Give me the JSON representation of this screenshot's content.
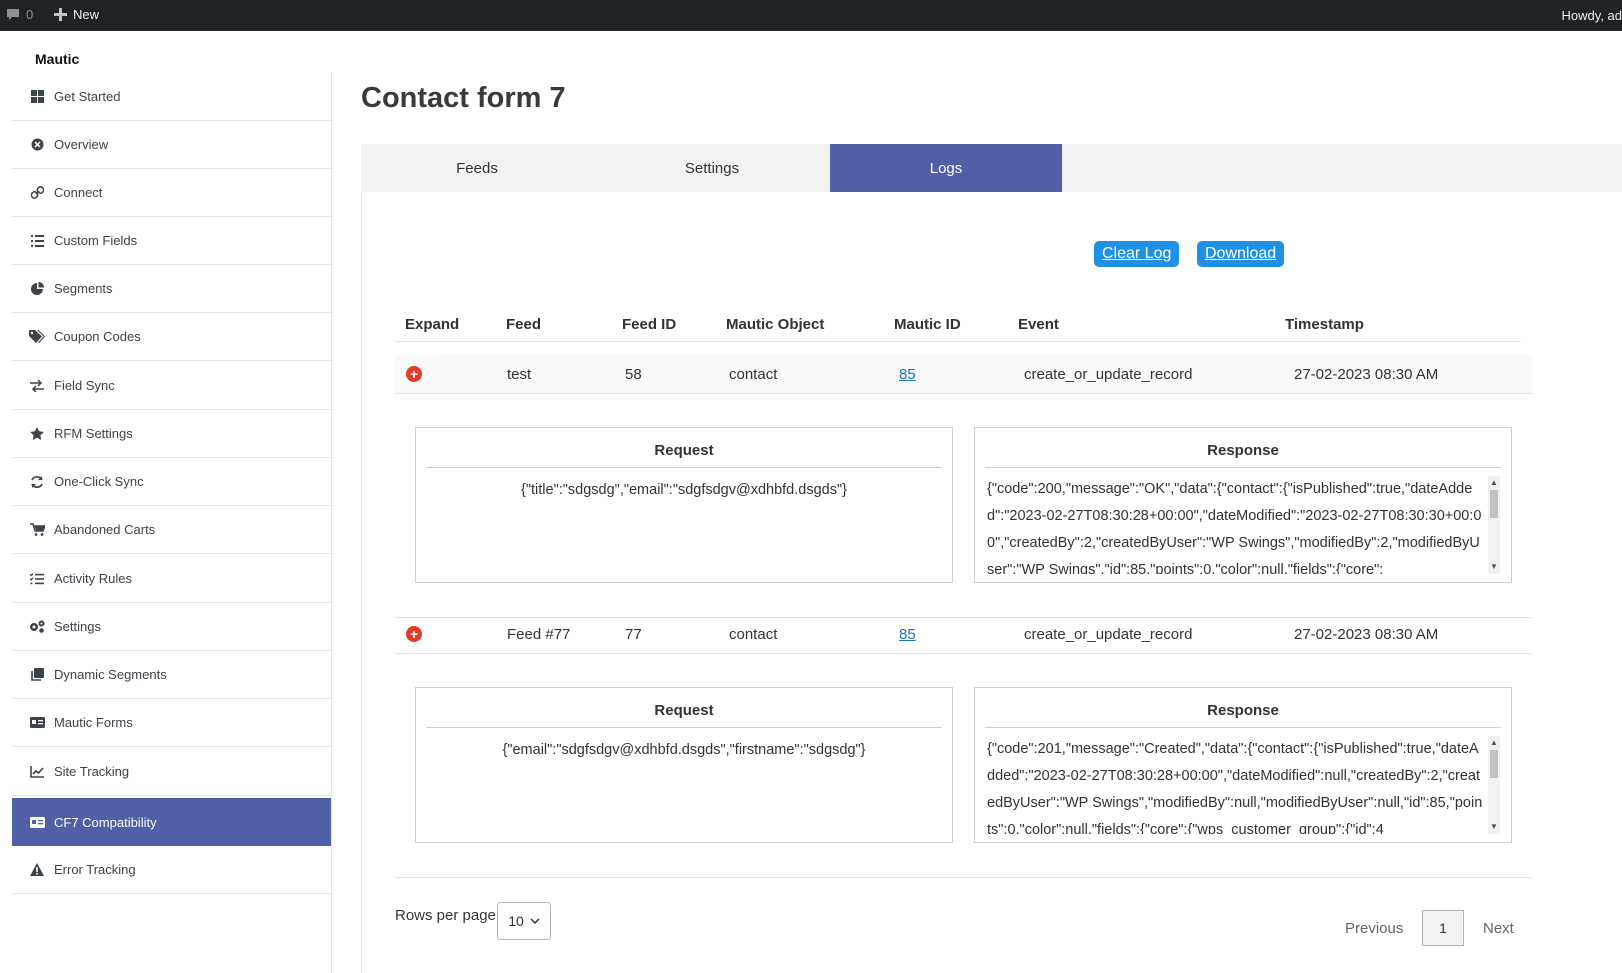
{
  "adminbar": {
    "comments_count": "0",
    "new_label": "New",
    "howdy": "Howdy, ad"
  },
  "brand": "Mautic",
  "colors": {
    "accent": "#5160a6",
    "button_blue": "#1e90e6",
    "expand_red": "#e53a2a",
    "adminbar": "#1d2327"
  },
  "sidebar": {
    "items": [
      {
        "label": "Get Started",
        "icon": "grid-icon"
      },
      {
        "label": "Overview",
        "icon": "overview-icon"
      },
      {
        "label": "Connect",
        "icon": "link-icon"
      },
      {
        "label": "Custom Fields",
        "icon": "list-icon"
      },
      {
        "label": "Segments",
        "icon": "pie-icon"
      },
      {
        "label": "Coupon Codes",
        "icon": "tags-icon"
      },
      {
        "label": "Field Sync",
        "icon": "sync-arrows-icon"
      },
      {
        "label": "RFM Settings",
        "icon": "star-icon"
      },
      {
        "label": "One-Click Sync",
        "icon": "refresh-icon"
      },
      {
        "label": "Abandoned Carts",
        "icon": "cart-icon"
      },
      {
        "label": "Activity Rules",
        "icon": "checklist-icon"
      },
      {
        "label": "Settings",
        "icon": "gears-icon"
      },
      {
        "label": "Dynamic Segments",
        "icon": "copy-icon"
      },
      {
        "label": "Mautic Forms",
        "icon": "id-card-icon"
      },
      {
        "label": "Site Tracking",
        "icon": "chart-line-icon"
      },
      {
        "label": "CF7 Compatibility",
        "icon": "id-card-icon"
      },
      {
        "label": "Error Tracking",
        "icon": "warning-icon"
      }
    ]
  },
  "page": {
    "title": "Contact form 7"
  },
  "tabs": [
    "Feeds",
    "Settings",
    "Logs"
  ],
  "actions": {
    "clear_log": "Clear Log",
    "download": "Download"
  },
  "table": {
    "headers": [
      "Expand",
      "Feed",
      "Feed ID",
      "Mautic Object",
      "Mautic ID",
      "Event",
      "Timestamp"
    ],
    "rows": [
      {
        "feed": "test",
        "feed_id": "58",
        "object": "contact",
        "mautic_id": "85",
        "event": "create_or_update_record",
        "timestamp": "27-02-2023 08:30 AM",
        "request_label": "Request",
        "response_label": "Response",
        "request": "{\"title\":\"sdgsdg\",\"email\":\"sdgfsdgv@xdhbfd.dsgds\"}",
        "response": "{\"code\":200,\"message\":\"OK\",\"data\":{\"contact\":{\"isPublished\":true,\"dateAdded\":\"2023-02-27T08:30:28+00:00\",\"dateModified\":\"2023-02-27T08:30:30+00:00\",\"createdBy\":2,\"createdByUser\":\"WP Swings\",\"modifiedBy\":2,\"modifiedByUser\":\"WP Swings\",\"id\":85,\"points\":0,\"color\":null,\"fields\":{\"core\":"
      },
      {
        "feed": "Feed #77",
        "feed_id": "77",
        "object": "contact",
        "mautic_id": "85",
        "event": "create_or_update_record",
        "timestamp": "27-02-2023 08:30 AM",
        "request_label": "Request",
        "response_label": "Response",
        "request": "{\"email\":\"sdgfsdgv@xdhbfd.dsgds\",\"firstname\":\"sdgsdg\"}",
        "response": "{\"code\":201,\"message\":\"Created\",\"data\":{\"contact\":{\"isPublished\":true,\"dateAdded\":\"2023-02-27T08:30:28+00:00\",\"dateModified\":null,\"createdBy\":2,\"createdByUser\":\"WP Swings\",\"modifiedBy\":null,\"modifiedByUser\":null,\"id\":85,\"points\":0,\"color\":null,\"fields\":{\"core\":{\"wps_customer_group\":{\"id\":4"
      }
    ]
  },
  "pagination": {
    "rows_per_page_label": "Rows per page",
    "rows_per_page": "10",
    "previous": "Previous",
    "current": "1",
    "next": "Next"
  }
}
